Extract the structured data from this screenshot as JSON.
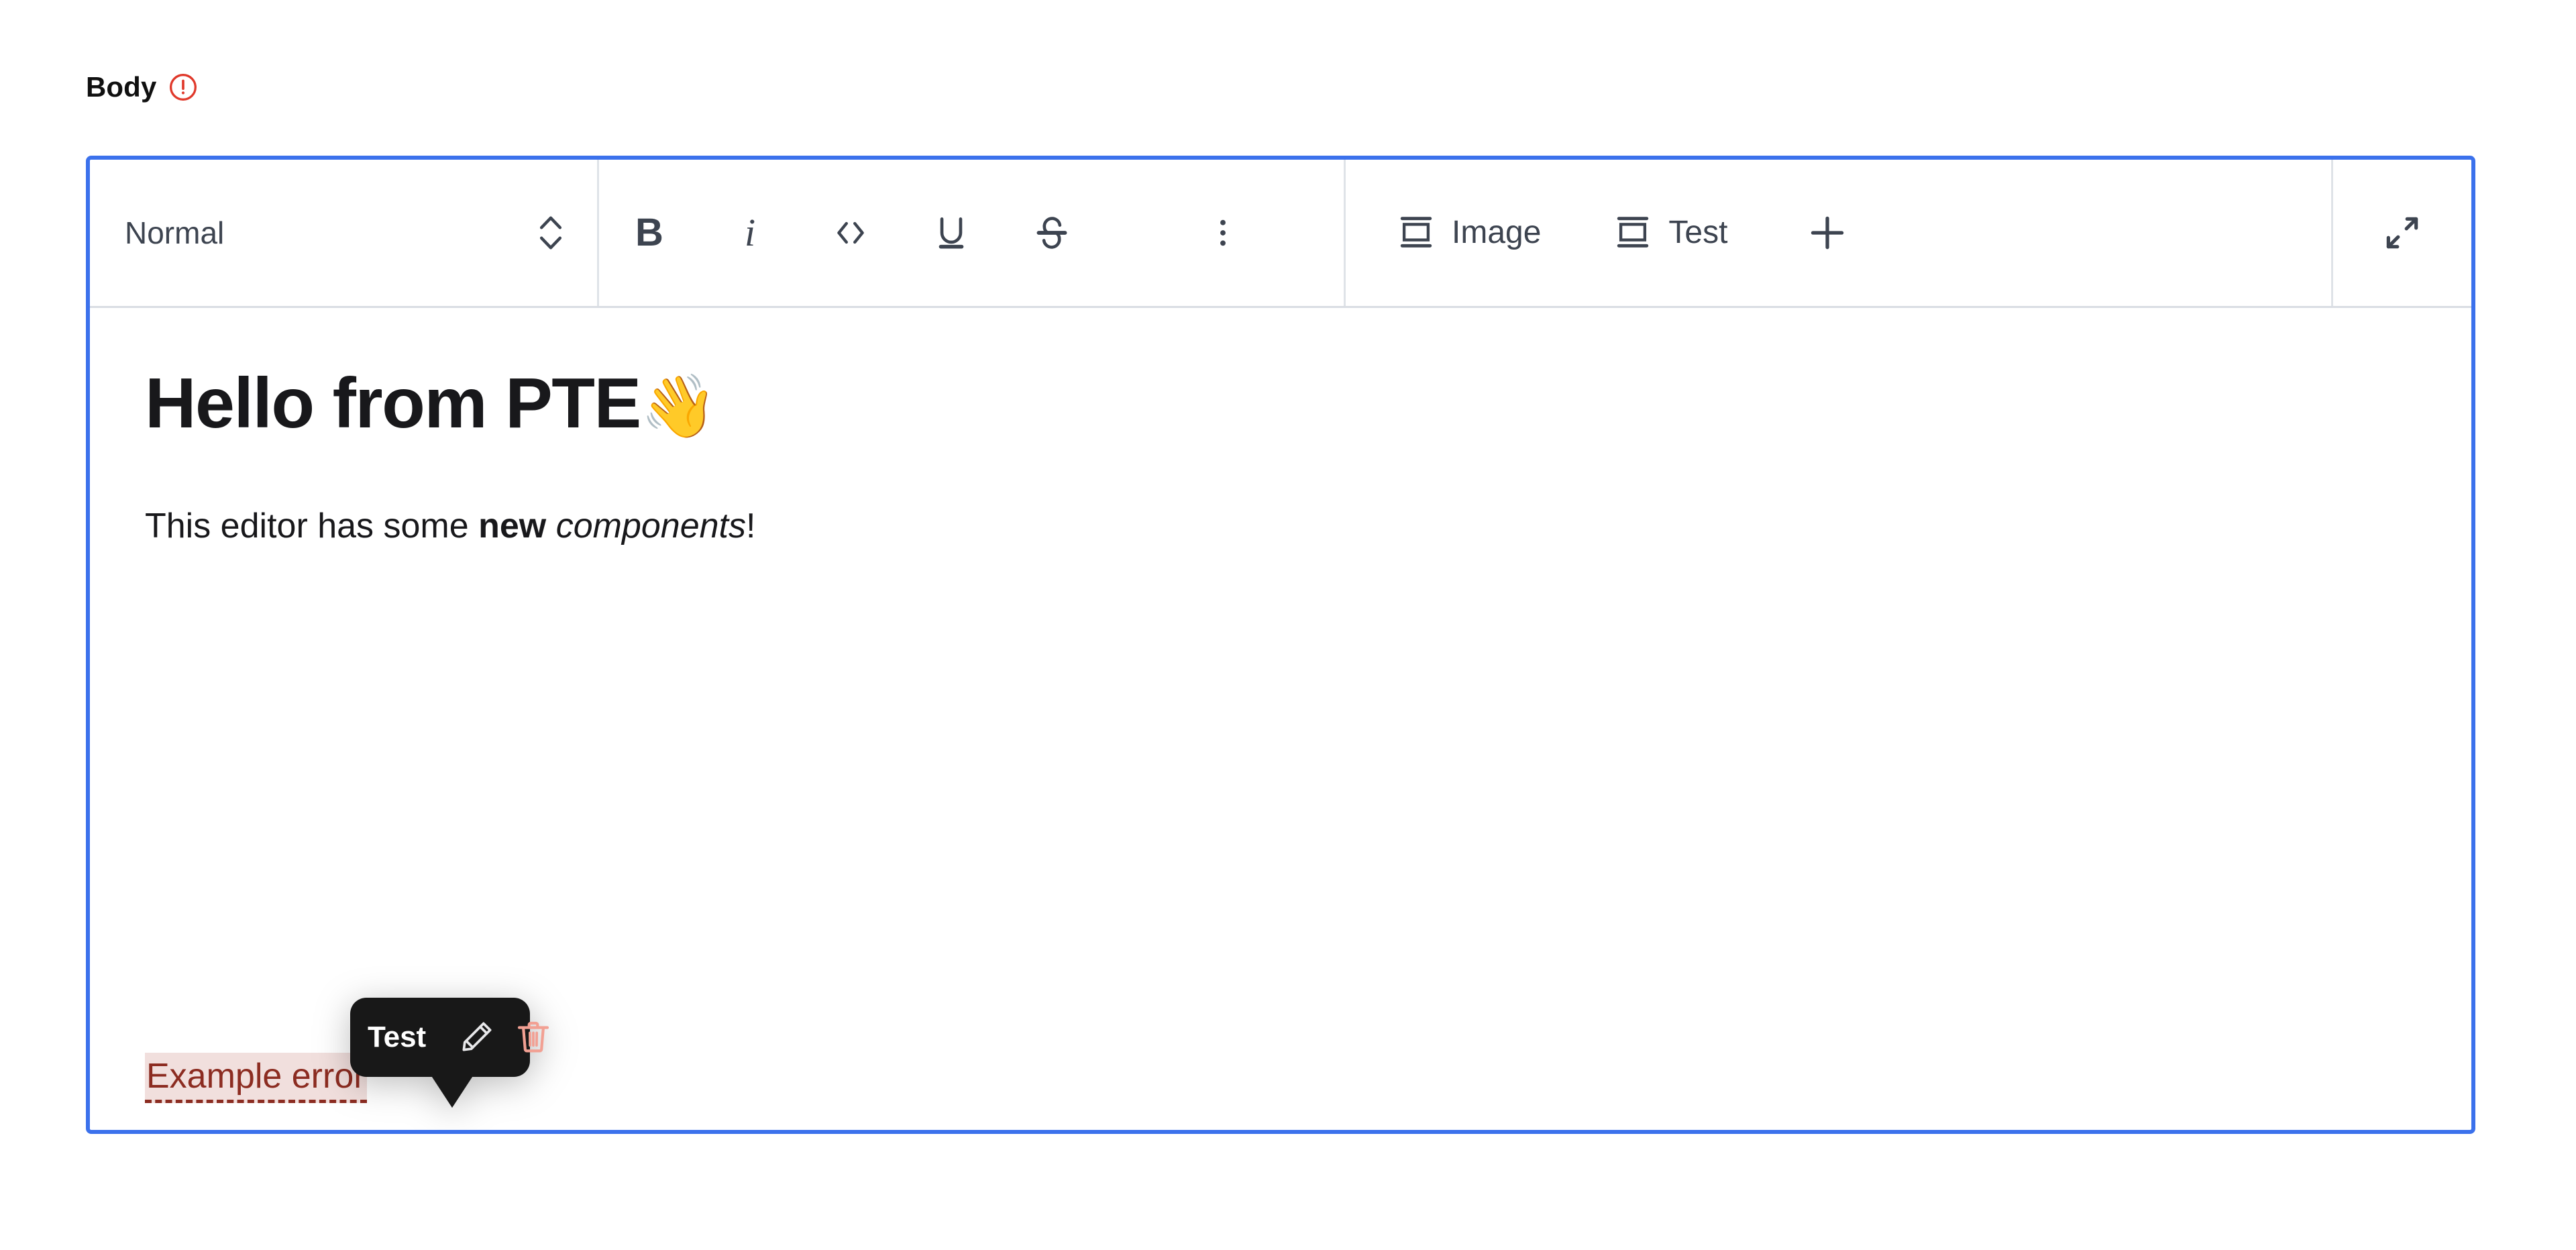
{
  "field": {
    "label": "Body",
    "error_icon": "error-circle-exclamation-icon",
    "error_color": "#e0392b",
    "focus_border_color": "#3b71ec"
  },
  "toolbar": {
    "block_format": {
      "selected": "Normal",
      "icon": "chevron-up-down-icon"
    },
    "inline_buttons": [
      {
        "name": "bold",
        "glyph": "B",
        "icon": "bold-icon"
      },
      {
        "name": "italic",
        "glyph": "i",
        "icon": "italic-icon"
      },
      {
        "name": "code",
        "glyph": "<>",
        "icon": "code-icon"
      },
      {
        "name": "underline",
        "glyph": "U",
        "icon": "underline-icon"
      },
      {
        "name": "strikethrough",
        "glyph": "S",
        "icon": "strikethrough-icon"
      }
    ],
    "more_button": {
      "label": "",
      "icon": "more-vertical-dots-icon"
    },
    "node_buttons": [
      {
        "label": "Image",
        "icon": "insert-block-icon"
      },
      {
        "label": "Test",
        "icon": "insert-block-icon"
      }
    ],
    "add_button": {
      "icon": "plus-icon"
    },
    "expand_button": {
      "icon": "expand-diagonal-arrows-icon"
    }
  },
  "document": {
    "heading": "Hello from PTE",
    "heading_emoji": "👋",
    "paragraph": {
      "before_bold": "This editor has some ",
      "bold": "new",
      "between": " ",
      "italic": "components",
      "after": "!"
    },
    "error_node_text": "Example error",
    "error_node_text_color": "#8c2c21",
    "error_node_highlight_color": "#f1dfdd",
    "clipped_node_border_color": "#efa79c"
  },
  "popover": {
    "label": "Test",
    "edit_button": {
      "icon": "pencil-edit-icon",
      "color": "#e8e8ea"
    },
    "delete_button": {
      "icon": "trash-delete-icon",
      "color": "#f2a093"
    },
    "background_color": "#181818"
  }
}
